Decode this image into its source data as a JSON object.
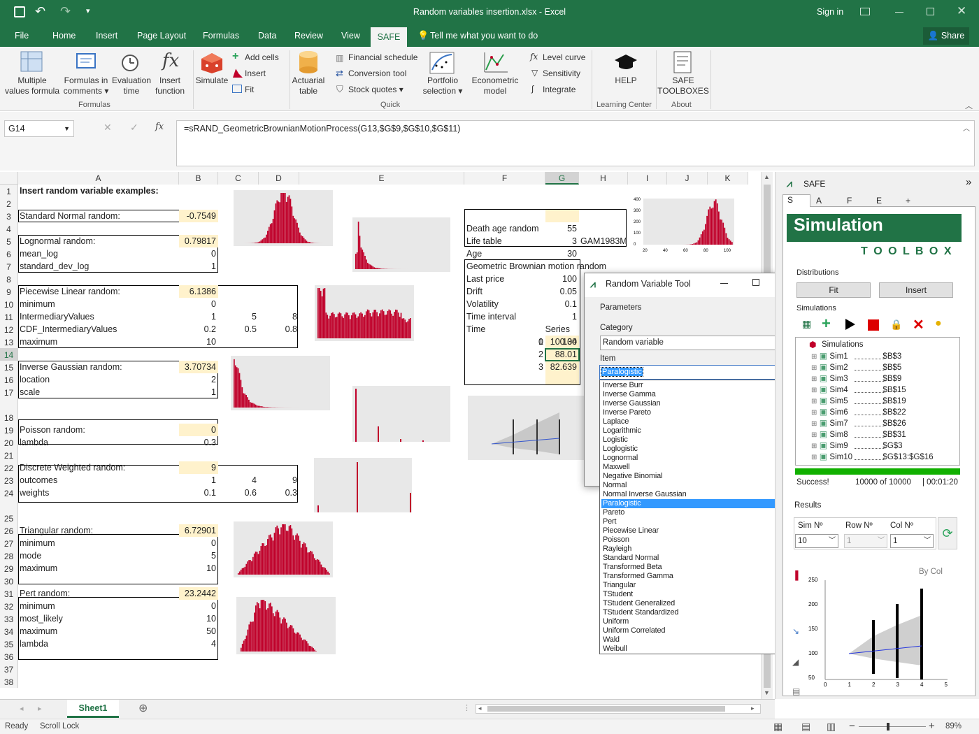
{
  "window": {
    "title": "Random variables insertion.xlsx - Excel",
    "sign_in": "Sign in"
  },
  "tabs": [
    {
      "label": "File"
    },
    {
      "label": "Home"
    },
    {
      "label": "Insert"
    },
    {
      "label": "Page Layout"
    },
    {
      "label": "Formulas"
    },
    {
      "label": "Data"
    },
    {
      "label": "Review"
    },
    {
      "label": "View"
    },
    {
      "label": "SAFE"
    },
    {
      "label": "Tell me what you want to do"
    }
  ],
  "share": "Share",
  "ribbon": {
    "multiple": "Multiple\nvalues formula",
    "formulas_in": "Formulas in\ncomments ▾",
    "evaluation": "Evaluation\ntime",
    "insert_function": "Insert\nfunction",
    "simulate": "Simulate",
    "add_cells": "Add cells",
    "insert": "Insert",
    "fit": "Fit",
    "actuarial": "Actuarial\ntable",
    "financial": "Financial schedule",
    "conversion": "Conversion tool",
    "stock": "Stock quotes ▾",
    "portfolio": "Portfolio\nselection ▾",
    "econometric": "Econometric\nmodel",
    "level_curve": "Level curve",
    "sensitivity": "Sensitivity",
    "integrate": "Integrate",
    "help": "HELP",
    "safe_toolboxes": "SAFE\nTOOLBOXES",
    "group_formulas": "Formulas",
    "group_quick": "Quick",
    "group_learning": "Learning Center",
    "group_about": "About"
  },
  "formula_bar": {
    "name_box": "G14",
    "fx": "fx",
    "formula": "=sRAND_GeometricBrownianMotionProcess(G13,$G$9,$G$10,$G$11)"
  },
  "columns": [
    "A",
    "B",
    "C",
    "D",
    "E",
    "F",
    "G",
    "H",
    "I",
    "J",
    "K"
  ],
  "rows": [
    "1",
    "2",
    "3",
    "4",
    "5",
    "6",
    "7",
    "8",
    "9",
    "10",
    "11",
    "12",
    "13",
    "14",
    "15",
    "16",
    "17",
    "18",
    "19",
    "20",
    "21",
    "22",
    "23",
    "24",
    "25",
    "26",
    "27",
    "28",
    "29",
    "30",
    "31",
    "32",
    "33",
    "34",
    "35",
    "36",
    "37",
    "38"
  ],
  "cells": {
    "a1": "Insert random variable examples:",
    "a3": "Standard Normal random:",
    "b3": "-0.7549",
    "a5": "Lognormal random:",
    "b5": "0.79817",
    "a6": "mean_log",
    "b6": "0",
    "a7": "standard_dev_log",
    "b7": "1",
    "a9": "Piecewise Linear random:",
    "b9": "6.1386",
    "a10": "minimum",
    "b10": "0",
    "a11": "IntermediaryValues",
    "b11": "1",
    "c11": "5",
    "d11": "8",
    "a12": "CDF_IntermediaryValues",
    "b12": "0.2",
    "c12": "0.5",
    "d12": "0.8",
    "a13": "maximum",
    "b13": "10",
    "a15": "Inverse Gaussian random:",
    "b15": "3.70734",
    "a16": "location",
    "b16": "2",
    "a17": "scale",
    "b17": "1",
    "a19": "Poisson random:",
    "b19": "0",
    "a20": "lambda",
    "b20": "0.3",
    "a22": "Discrete Weighted random:",
    "b22": "9",
    "a23": "outcomes",
    "b23": "1",
    "c23": "4",
    "d23": "9",
    "a24": "weights",
    "b24": "0.1",
    "c24": "0.6",
    "d24": "0.3",
    "a26": "Triangular random:",
    "b26": "6.72901",
    "a27": "minimum",
    "b27": "0",
    "a28": "mode",
    "b28": "5",
    "a29": "maximum",
    "b29": "10",
    "a31": "Pert random:",
    "b31": "23.2442",
    "a32": "minimum",
    "b32": "0",
    "a33": "most_likely",
    "b33": "10",
    "a34": "maximum",
    "b34": "50",
    "a35": "lambda",
    "b35": "4",
    "f3": "Death age random",
    "g3": "55",
    "f4": "Life table",
    "g4": "3",
    "h4": "GAM1983M",
    "f5": "Age",
    "g5": "30",
    "f8": "Geometric Brownian motion random",
    "f9": "Last price",
    "g9": "100",
    "f10": "Drift",
    "g10": "0.05",
    "f11": "Volatility",
    "g11": "0.1",
    "f12": "Time interval",
    "g12": "1",
    "f13": "Time",
    "g13": "Series",
    "f14a": "0",
    "g14a": "100",
    "f14": "1",
    "g14": "100.34",
    "f15": "2",
    "g15": "88.01",
    "f16": "3",
    "g16": "82.639"
  },
  "charts_small": {
    "death_x": [
      "20",
      "40",
      "60",
      "80",
      "100"
    ],
    "death_y": [
      "400",
      "300",
      "200",
      "100",
      "0"
    ]
  },
  "dialog": {
    "title": "Random Variable Tool",
    "parameters": "Parameters",
    "category_label": "Category",
    "category_value": "Random variable",
    "item_label": "Item",
    "item_value": "Paralogistic",
    "items": [
      "Inverse Burr",
      "Inverse Gamma",
      "Inverse Gaussian",
      "Inverse Pareto",
      "Laplace",
      "Logarithmic",
      "Logistic",
      "Loglogistic",
      "Lognormal",
      "Maxwell",
      "Negative Binomial",
      "Normal",
      "Normal Inverse Gaussian",
      "Paralogistic",
      "Pareto",
      "Pert",
      "Piecewise Linear",
      "Poisson",
      "Rayleigh",
      "Standard Normal",
      "Transformed Beta",
      "Transformed Gamma",
      "Triangular",
      "TStudent",
      "TStudent Generalized",
      "TStudent Standardized",
      "Uniform",
      "Uniform Correlated",
      "Wald",
      "Weibull"
    ],
    "selected_index": 13
  },
  "safe_panel": {
    "header": "SAFE",
    "tabs": [
      "S",
      "A",
      "F",
      "E",
      "+"
    ],
    "banner": "Simulation",
    "toolbox": "T O O L B O X",
    "distributions": "Distributions",
    "fit": "Fit",
    "insert": "Insert",
    "simulations_label": "Simulations",
    "tree_root": "Simulations",
    "sims": [
      {
        "name": "Sim1",
        "ref": "$B$3"
      },
      {
        "name": "Sim2",
        "ref": "$B$5"
      },
      {
        "name": "Sim3",
        "ref": "$B$9"
      },
      {
        "name": "Sim4",
        "ref": "$B$15"
      },
      {
        "name": "Sim5",
        "ref": "$B$19"
      },
      {
        "name": "Sim6",
        "ref": "$B$22"
      },
      {
        "name": "Sim7",
        "ref": "$B$26"
      },
      {
        "name": "Sim8",
        "ref": "$B$31"
      },
      {
        "name": "Sim9",
        "ref": "$G$3"
      },
      {
        "name": "Sim10",
        "ref": "$G$13:$G$16"
      }
    ],
    "status": "Success!",
    "progress_text": "10000 of 10000",
    "elapsed": "| 00:01:20",
    "progress": 1.0,
    "results": "Results",
    "sim_no": "Sim Nº",
    "sim_val": "10",
    "row_no": "Row Nº",
    "row_val": "1",
    "col_no": "Col Nº",
    "col_val": "1",
    "by_col": "By Col",
    "y_ticks": [
      "250",
      "200",
      "150",
      "100",
      "50"
    ],
    "x_ticks": [
      "0",
      "1",
      "2",
      "3",
      "4",
      "5"
    ]
  },
  "sheet_tab": "Sheet1",
  "status": {
    "ready": "Ready",
    "scroll_lock": "Scroll Lock",
    "zoom": "89%"
  },
  "colors": {
    "accent": "#217346",
    "bars": "#c0002a",
    "selected": "#3399ff",
    "highlight": "#fff2cc"
  }
}
